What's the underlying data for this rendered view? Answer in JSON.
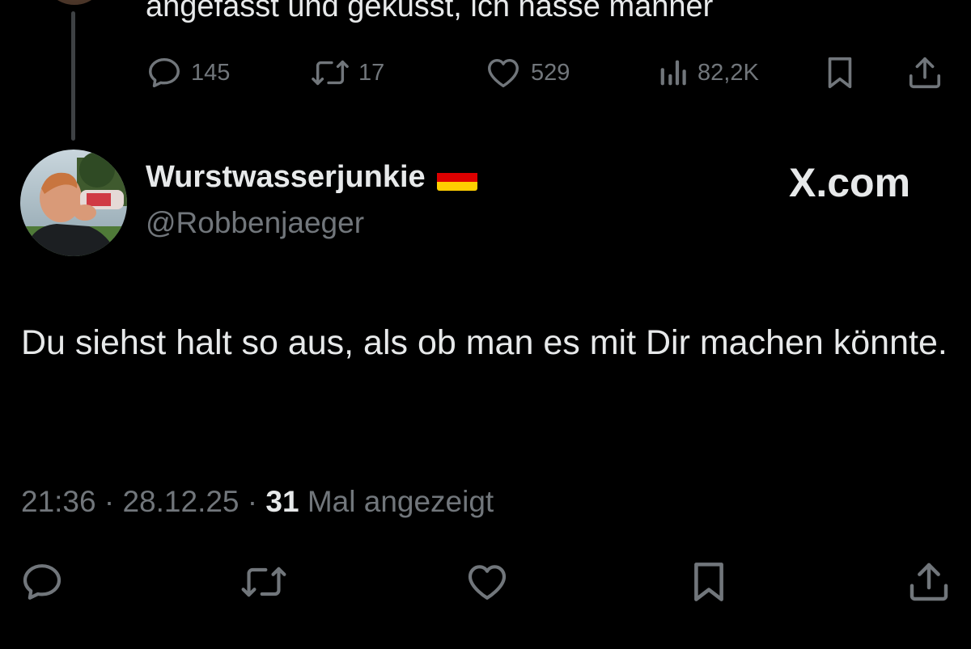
{
  "parent_tweet": {
    "text": "angefasst und geküsst, ich hasse männer",
    "replies": "145",
    "reposts": "17",
    "likes": "529",
    "views": "82,2K",
    "icons": [
      "reply-icon",
      "repost-icon",
      "like-icon",
      "views-icon",
      "bookmark-icon",
      "share-icon"
    ]
  },
  "tweet": {
    "display_name": "Wurstwasserjunkie",
    "flag": "🇩🇪",
    "handle": "@Robbenjaeger",
    "watermark": "X.com",
    "body": "Du siehst halt so aus, als ob man es mit Dir machen könnte.",
    "time": "21:36",
    "separator": " · ",
    "date": "28.12.25",
    "views_count": "31",
    "views_label": " Mal angezeigt"
  },
  "colors": {
    "background": "#000000",
    "text": "#e7e9ea",
    "muted": "#71767b",
    "thread_line": "#3e4144",
    "flag_black": "#000000",
    "flag_red": "#dd0000",
    "flag_gold": "#ffce00"
  },
  "action_bar_icons": [
    "reply-icon",
    "repost-icon",
    "like-icon",
    "bookmark-icon",
    "share-icon"
  ]
}
